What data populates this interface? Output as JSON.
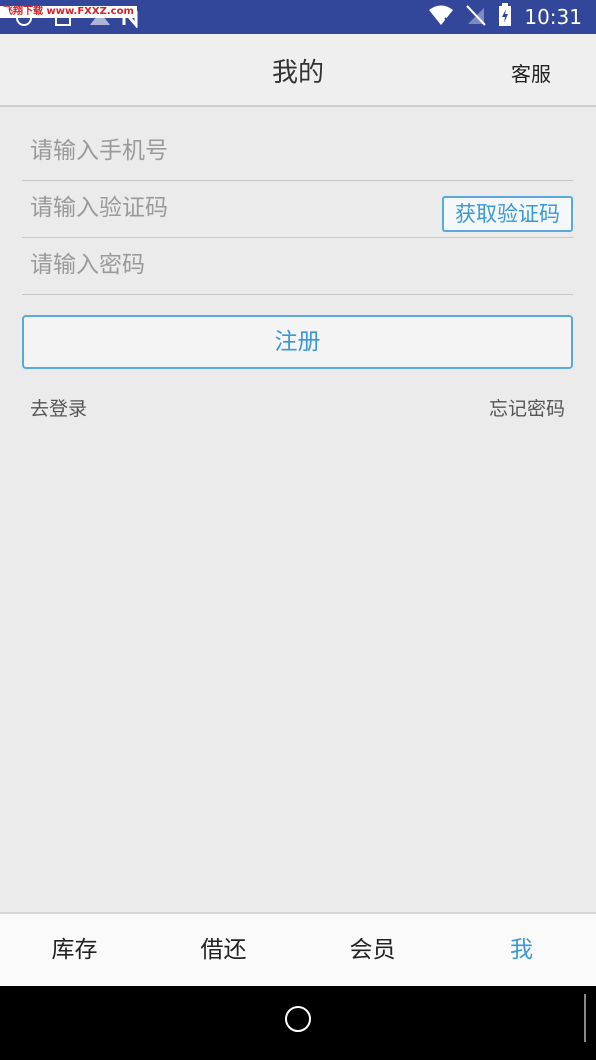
{
  "status_bar": {
    "watermark": "飞翔下载 www.FXXZ.com",
    "time": "10:31",
    "icons": [
      "wifi-icon",
      "no-sim-icon",
      "battery-charging-icon"
    ]
  },
  "header": {
    "title": "我的",
    "service_label": "客服"
  },
  "form": {
    "phone_placeholder": "请输入手机号",
    "phone_value": "",
    "code_placeholder": "请输入验证码",
    "code_value": "",
    "get_code_label": "获取验证码",
    "password_placeholder": "请输入密码",
    "password_value": "",
    "register_label": "注册",
    "login_link": "去登录",
    "forgot_link": "忘记密码"
  },
  "tabs": [
    {
      "label": "库存",
      "active": false
    },
    {
      "label": "借还",
      "active": false
    },
    {
      "label": "会员",
      "active": false
    },
    {
      "label": "我",
      "active": true
    }
  ],
  "colors": {
    "status_bar": "#33479a",
    "accent": "#3a98d8",
    "background": "#ebebeb"
  }
}
